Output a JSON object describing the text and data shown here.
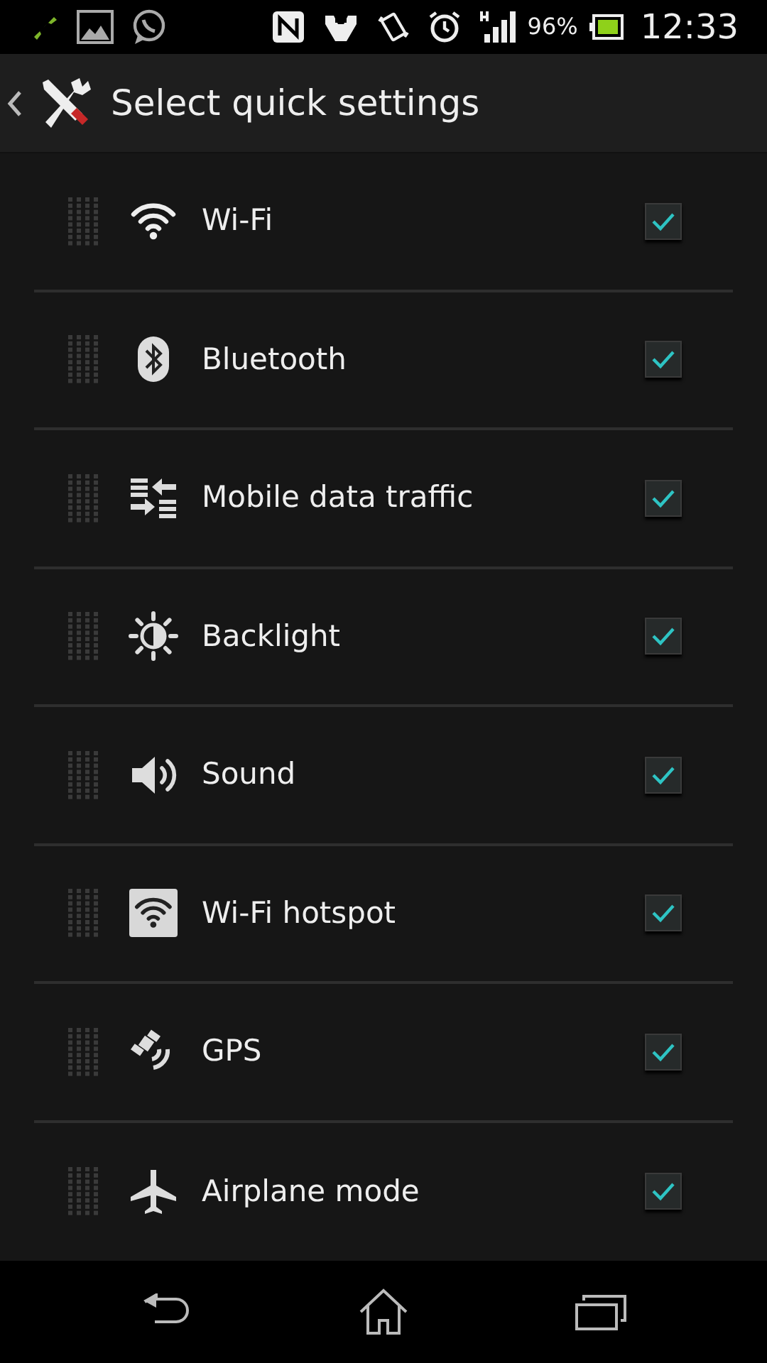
{
  "status_bar": {
    "battery": "96%",
    "time": "12:33"
  },
  "action_bar": {
    "title": "Select quick settings"
  },
  "items": [
    {
      "kind": "wifi",
      "label": "Wi-Fi",
      "checked": true
    },
    {
      "kind": "bluetooth",
      "label": "Bluetooth",
      "checked": true
    },
    {
      "kind": "data",
      "label": "Mobile data traffic",
      "checked": true
    },
    {
      "kind": "backlight",
      "label": "Backlight",
      "checked": true
    },
    {
      "kind": "sound",
      "label": "Sound",
      "checked": true
    },
    {
      "kind": "hotspot",
      "label": "Wi-Fi hotspot",
      "checked": true
    },
    {
      "kind": "gps",
      "label": "GPS",
      "checked": true
    },
    {
      "kind": "airplane",
      "label": "Airplane mode",
      "checked": true
    }
  ]
}
